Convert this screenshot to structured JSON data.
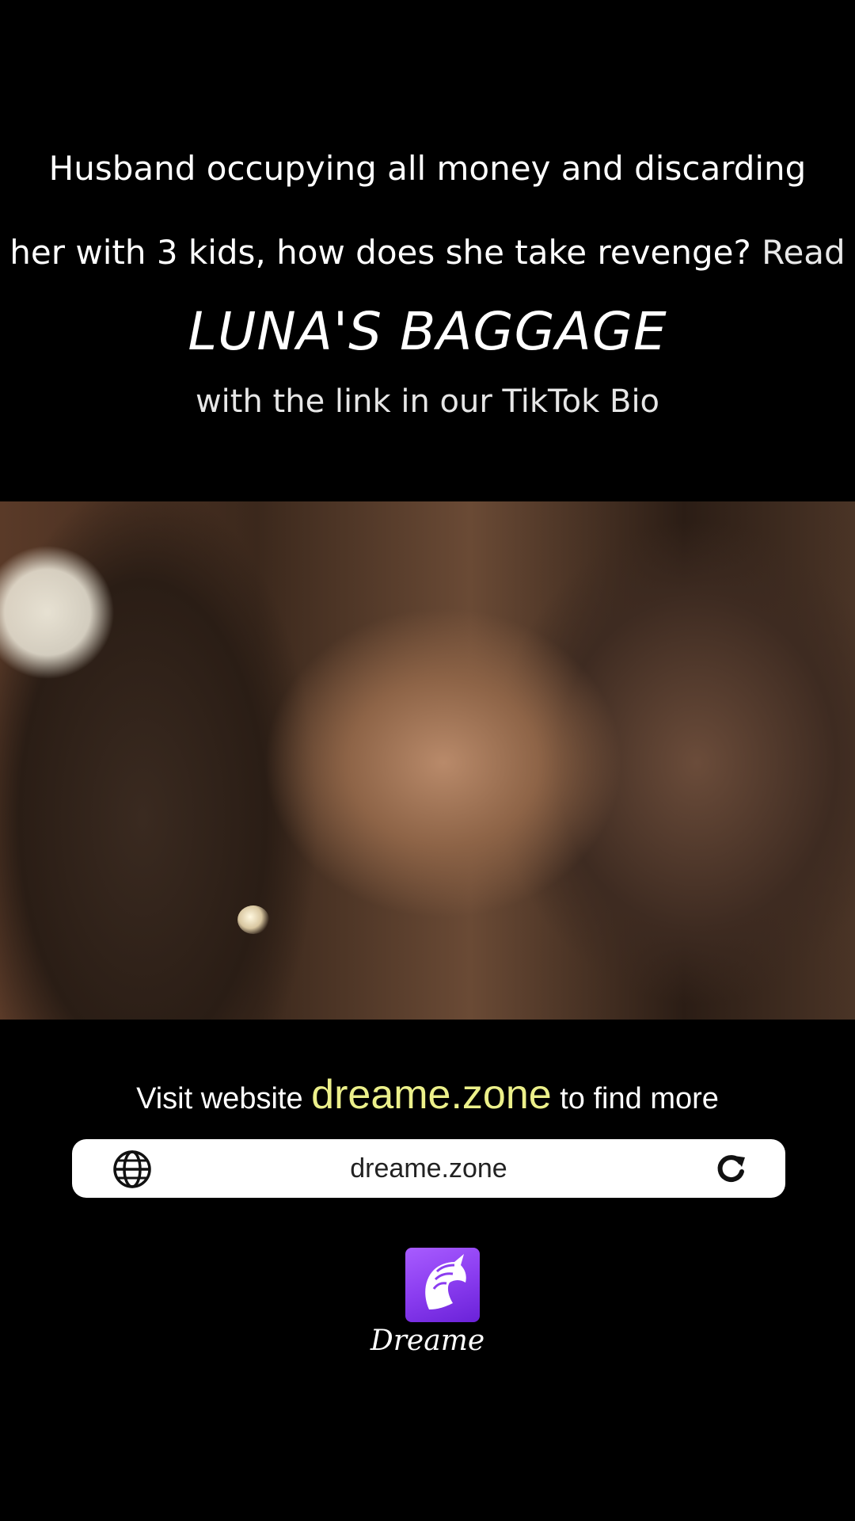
{
  "headline": {
    "line1": "Husband occupying all money and discarding",
    "line2": "her with 3 kids, how does she take revenge?",
    "read_word": "Read"
  },
  "book_title": "LUNA'S BAGGAGE",
  "subline": "with the link in our TikTok Bio",
  "visit": {
    "prefix": "Visit website",
    "site": "dreame.zone",
    "suffix": "to find more"
  },
  "address_bar": {
    "url": "dreame.zone",
    "left_icon": "globe-icon",
    "right_icon": "reload-icon"
  },
  "brand": {
    "name": "Dreame",
    "logo_icon": "unicorn-logo-icon",
    "color": "#8b3df0"
  },
  "colors": {
    "background": "#000000",
    "site_highlight": "#ecf08a"
  }
}
